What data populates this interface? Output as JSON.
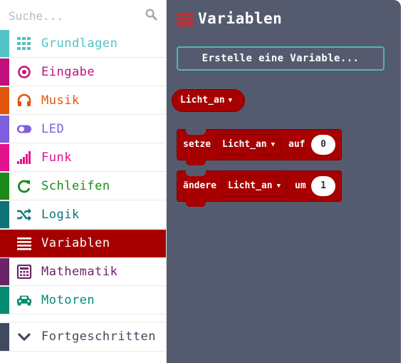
{
  "search": {
    "placeholder": "Suche..."
  },
  "categories": [
    {
      "label": "Grundlagen",
      "color": "#4fc3c5",
      "icon": "grid-icon"
    },
    {
      "label": "Eingabe",
      "color": "#c2107c",
      "icon": "target-icon"
    },
    {
      "label": "Musik",
      "color": "#e1560d",
      "icon": "headphones-icon"
    },
    {
      "label": "LED",
      "color": "#7e5ee0",
      "icon": "toggle-icon"
    },
    {
      "label": "Funk",
      "color": "#e3128c",
      "icon": "signal-bars-icon"
    },
    {
      "label": "Schleifen",
      "color": "#1a8a18",
      "icon": "refresh-icon"
    },
    {
      "label": "Logik",
      "color": "#0f7277",
      "icon": "shuffle-icon"
    },
    {
      "label": "Variablen",
      "color": "#a60000",
      "icon": "list-lines-icon",
      "active": true
    },
    {
      "label": "Mathematik",
      "color": "#6b2468",
      "icon": "calculator-icon"
    },
    {
      "label": "Motoren",
      "color": "#068a73",
      "icon": "car-icon"
    },
    {
      "label": "Fortgeschritten",
      "color": "#404a5e",
      "icon": "chevron-down-icon"
    }
  ],
  "flyout": {
    "title": "Variablen",
    "make_variable": "Erstelle eine Variable...",
    "variable_pill": "Licht_an",
    "set_block": {
      "keyword": "setze",
      "variable": "Licht_an",
      "connector": "auf",
      "value": "0"
    },
    "change_block": {
      "keyword": "ändere",
      "variable": "Licht_an",
      "connector": "um",
      "value": "1"
    },
    "background": "#555b6e",
    "block_color": "#a60000"
  }
}
